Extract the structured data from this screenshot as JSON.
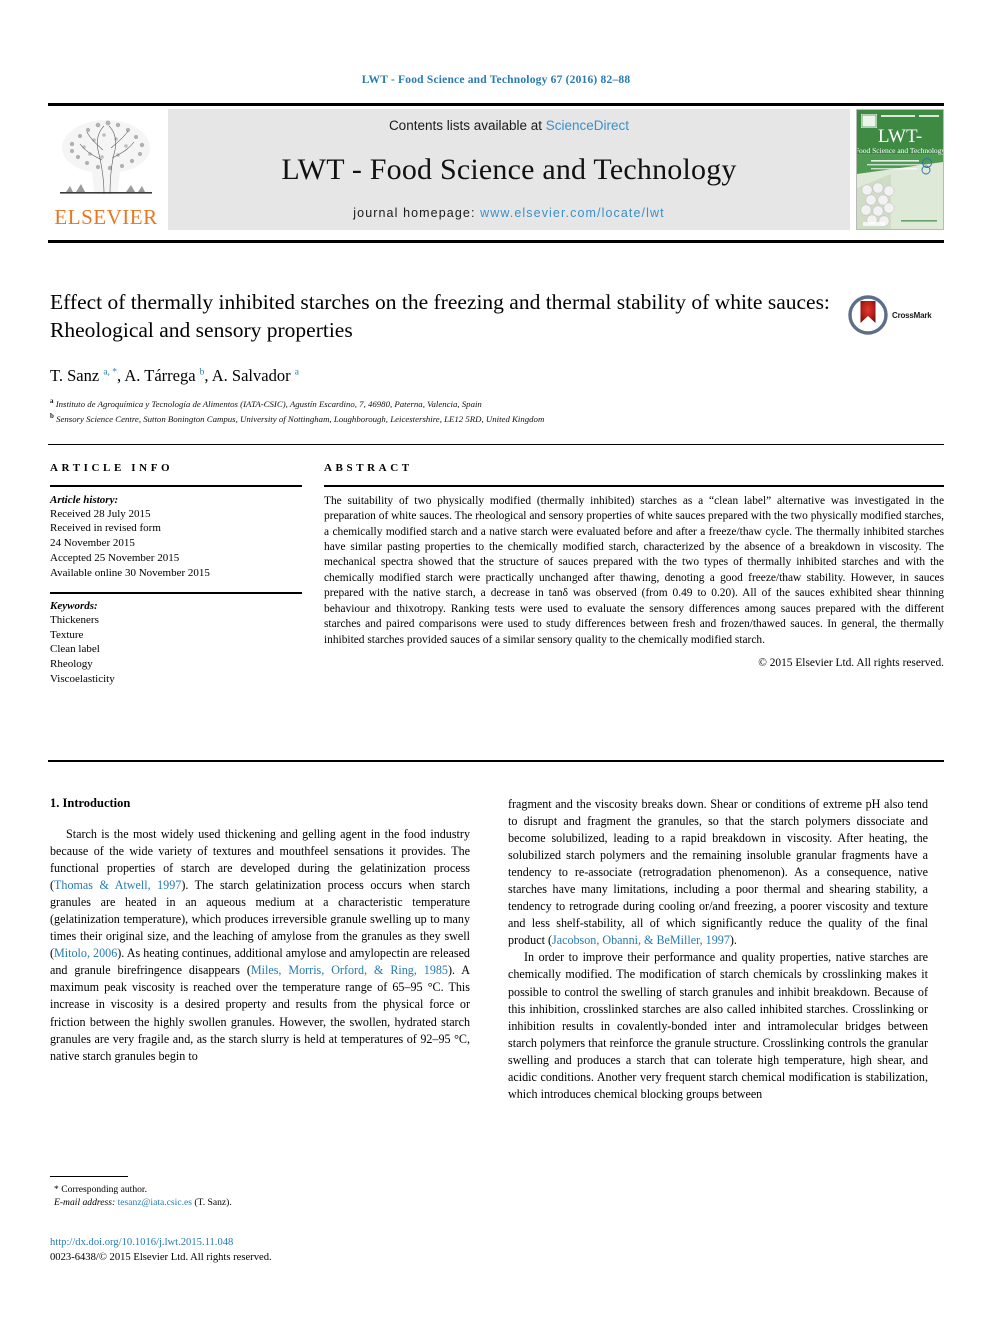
{
  "running_head": "LWT - Food Science and Technology 67 (2016) 82–88",
  "journal_header": {
    "contents_prefix": "Contents lists available at ",
    "sciencedirect": "ScienceDirect",
    "journal_title": "LWT - Food Science and Technology",
    "homepage_prefix": "journal homepage: ",
    "homepage_url": "www.elsevier.com/locate/lwt",
    "publisher_logo_text": "ELSEVIER",
    "cover_title_main": "LWT-",
    "cover_title_sub": "Food Science and Technology",
    "link_color": "#3a90c8",
    "elsevier_orange": "#e87722",
    "band_color": "#e6e6e6"
  },
  "article": {
    "title": "Effect of thermally inhibited starches on the freezing and thermal stability of white sauces: Rheological and sensory properties",
    "crossmark_label": "CrossMark",
    "authors_html": "T. Sanz <sup>a, *</sup>, A. Tárrega <sup>b</sup>, A. Salvador <sup>a</sup>",
    "affiliations": [
      {
        "marker": "a",
        "text": "Instituto de Agroquímica y Tecnología de Alimentos (IATA-CSIC), Agustín Escardino, 7, 46980, Paterna, Valencia, Spain"
      },
      {
        "marker": "b",
        "text": "Sensory Science Centre, Sutton Bonington Campus, University of Nottingham, Loughborough, Leicestershire, LE12 5RD, United Kingdom"
      }
    ]
  },
  "article_info": {
    "heading": "ARTICLE INFO",
    "history_label": "Article history:",
    "history": [
      "Received 28 July 2015",
      "Received in revised form",
      "24 November 2015",
      "Accepted 25 November 2015",
      "Available online 30 November 2015"
    ],
    "keywords_label": "Keywords:",
    "keywords": [
      "Thickeners",
      "Texture",
      "Clean label",
      "Rheology",
      "Viscoelasticity"
    ]
  },
  "abstract": {
    "heading": "ABSTRACT",
    "text": "The suitability of two physically modified (thermally inhibited) starches as a “clean label” alternative was investigated in the preparation of white sauces. The rheological and sensory properties of white sauces prepared with the two physically modified starches, a chemically modified starch and a native starch were evaluated before and after a freeze/thaw cycle. The thermally inhibited starches have similar pasting properties to the chemically modified starch, characterized by the absence of a breakdown in viscosity. The mechanical spectra showed that the structure of sauces prepared with the two types of thermally inhibited starches and with the chemically modified starch were practically unchanged after thawing, denoting a good freeze/thaw stability. However, in sauces prepared with the native starch, a decrease in tanδ was observed (from 0.49 to 0.20). All of the sauces exhibited shear thinning behaviour and thixotropy. Ranking tests were used to evaluate the sensory differences among sauces prepared with the different starches and paired comparisons were used to study differences between fresh and frozen/thawed sauces. In general, the thermally inhibited starches provided sauces of a similar sensory quality to the chemically modified starch.",
    "copyright": "© 2015 Elsevier Ltd. All rights reserved."
  },
  "body": {
    "section_title": "1. Introduction",
    "left_para_1_a": "Starch is the most widely used thickening and gelling agent in the food industry because of the wide variety of textures and mouthfeel sensations it provides. The functional properties of starch are developed during the gelatinization process (",
    "left_cite_1": "Thomas & Atwell, 1997",
    "left_para_1_b": "). The starch gelatinization process occurs when starch granules are heated in an aqueous medium at a characteristic temperature (gelatinization temperature), which produces irreversible granule swelling up to many times their original size, and the leaching of amylose from the granules as they swell (",
    "left_cite_2": "Mitolo, 2006",
    "left_para_1_c": "). As heating continues, additional amylose and amylopectin are released and granule birefringence disappears (",
    "left_cite_3": "Miles, Morris, Orford, & Ring, 1985",
    "left_para_1_d": "). A maximum peak viscosity is reached over the temperature range of 65–95 °C. This increase in viscosity is a desired property and results from the physical force or friction between the highly swollen granules. However, the swollen, hydrated starch granules are very fragile and, as the starch slurry is held at temperatures of 92–95 °C, native starch granules begin to",
    "right_para_1_a": "fragment and the viscosity breaks down. Shear or conditions of extreme pH also tend to disrupt and fragment the granules, so that the starch polymers dissociate and become solubilized, leading to a rapid breakdown in viscosity. After heating, the solubilized starch polymers and the remaining insoluble granular fragments have a tendency to re-associate (retrogradation phenomenon). As a consequence, native starches have many limitations, including a poor thermal and shearing stability, a tendency to retrograde during cooling or/and freezing, a poorer viscosity and texture and less shelf-stability, all of which significantly reduce the quality of the final product (",
    "right_cite_1": "Jacobson, Obanni, & BeMiller, 1997",
    "right_para_1_b": ").",
    "right_para_2": "In order to improve their performance and quality properties, native starches are chemically modified. The modification of starch chemicals by crosslinking makes it possible to control the swelling of starch granules and inhibit breakdown. Because of this inhibition, crosslinked starches are also called inhibited starches. Crosslinking or inhibition results in covalently-bonded inter and intramolecular bridges between starch polymers that reinforce the granule structure. Crosslinking controls the granular swelling and produces a starch that can tolerate high temperature, high shear, and acidic conditions. Another very frequent starch chemical modification is stabilization, which introduces chemical blocking groups between"
  },
  "footer": {
    "corresponding_author": "* Corresponding author.",
    "email_label": "E-mail address:",
    "email": "tesanz@iata.csic.es",
    "email_suffix": " (T. Sanz).",
    "doi": "http://dx.doi.org/10.1016/j.lwt.2015.11.048",
    "issn_line": "0023-6438/© 2015 Elsevier Ltd. All rights reserved."
  }
}
